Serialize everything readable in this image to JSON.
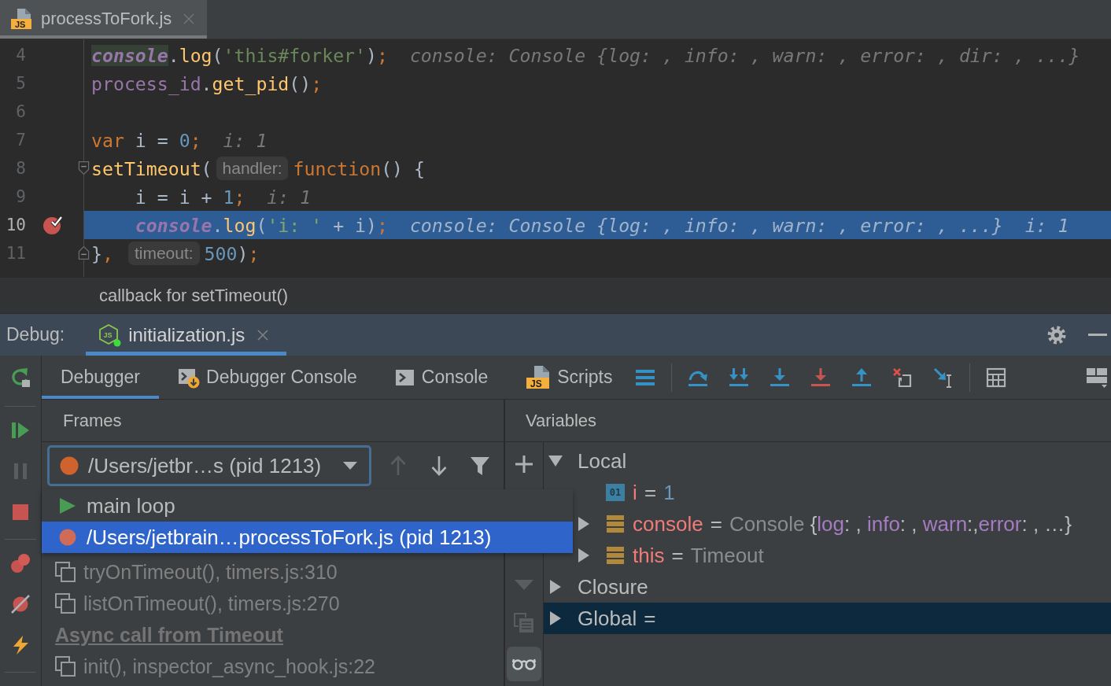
{
  "editor_tab": {
    "icon_text": "JS",
    "title": "processToFork.js",
    "selected": true
  },
  "editor": {
    "lines": [
      {
        "number": "4",
        "kind": "plain",
        "breakpoint": false,
        "current": false,
        "indented": false,
        "tokens": [
          {
            "kind": "usage",
            "text": "console"
          },
          {
            "kind": "plain",
            "text": "."
          },
          {
            "kind": "fn",
            "text": "log"
          },
          {
            "kind": "plain",
            "text": "("
          },
          {
            "kind": "str",
            "text": "'this#forker'"
          },
          {
            "kind": "plain",
            "text": ")"
          },
          {
            "kind": "kw",
            "text": ";"
          },
          {
            "kind": "value",
            "text": "console: Console {log: , info: , warn: , error: , dir: , ...}"
          }
        ]
      },
      {
        "number": "5",
        "kind": "plain",
        "breakpoint": false,
        "current": false,
        "indented": false,
        "tokens": [
          {
            "kind": "member",
            "text": "process_id"
          },
          {
            "kind": "plain",
            "text": "."
          },
          {
            "kind": "fn",
            "text": "get_pid"
          },
          {
            "kind": "plain",
            "text": "()"
          },
          {
            "kind": "kw",
            "text": ";"
          }
        ]
      },
      {
        "number": "6",
        "kind": "plain",
        "breakpoint": false,
        "current": false
      },
      {
        "number": "7",
        "kind": "plain",
        "breakpoint": false,
        "current": false,
        "indented": false,
        "tokens": [
          {
            "kind": "kw",
            "text": "var"
          },
          {
            "kind": "plain",
            "text": " i = "
          },
          {
            "kind": "num",
            "text": "0"
          },
          {
            "kind": "kw",
            "text": ";"
          },
          {
            "kind": "value",
            "text": "i: 1"
          }
        ]
      },
      {
        "number": "8",
        "kind": "foldstart",
        "breakpoint": false,
        "current": false,
        "indented": false,
        "tokens": [
          {
            "kind": "fn",
            "text": "setTimeout"
          },
          {
            "kind": "plain",
            "text": "("
          },
          {
            "kind": "hint",
            "text": "handler:"
          },
          {
            "kind": "kw",
            "text": "function"
          },
          {
            "kind": "plain",
            "text": "() {"
          }
        ]
      },
      {
        "number": "9",
        "kind": "plain",
        "breakpoint": false,
        "current": false,
        "indented": true,
        "tokens": [
          {
            "kind": "plain",
            "text": "i = i + "
          },
          {
            "kind": "num",
            "text": "1"
          },
          {
            "kind": "kw",
            "text": ";"
          },
          {
            "kind": "value",
            "text": "i: 1"
          }
        ]
      },
      {
        "number": "10",
        "kind": "plain",
        "breakpoint": true,
        "current": true,
        "indented": true,
        "tokens": [
          {
            "kind": "global",
            "text": "console"
          },
          {
            "kind": "plain",
            "text": "."
          },
          {
            "kind": "fn",
            "text": "log"
          },
          {
            "kind": "plain",
            "text": "("
          },
          {
            "kind": "str",
            "text": "'i: '"
          },
          {
            "kind": "plain",
            "text": " + i)"
          },
          {
            "kind": "kw",
            "text": ";"
          },
          {
            "kind": "value",
            "text": "console: Console {log: , info: , warn: , error: , ...}"
          },
          {
            "kind": "value",
            "text": "i: 1"
          }
        ]
      },
      {
        "number": "11",
        "kind": "foldend",
        "breakpoint": false,
        "current": false,
        "indented": false,
        "tokens": [
          {
            "kind": "plain",
            "text": "}"
          },
          {
            "kind": "kw",
            "text": ", "
          },
          {
            "kind": "hint",
            "text": "timeout:"
          },
          {
            "kind": "num",
            "text": "500"
          },
          {
            "kind": "plain",
            "text": ")"
          },
          {
            "kind": "kw",
            "text": ";"
          }
        ]
      }
    ]
  },
  "breadcrumb": "callback for setTimeout()",
  "debug": {
    "label": "Debug:",
    "sessions": [
      {
        "icon_text": "JS",
        "title": "initialization.js",
        "selected": true
      }
    ],
    "side_toolbar": [
      [
        {
          "kind": "rerun",
          "disabled": false
        }
      ],
      [
        {
          "kind": "resume",
          "disabled": false
        },
        {
          "kind": "pause",
          "disabled": true
        },
        {
          "kind": "stop",
          "disabled": false
        }
      ],
      [
        {
          "kind": "breakpoints",
          "disabled": false
        },
        {
          "kind": "mute",
          "disabled": false
        },
        {
          "kind": "lightning",
          "disabled": false
        }
      ]
    ],
    "view_tabs": [
      {
        "kind": "plain",
        "label": "Debugger",
        "selected": true
      },
      {
        "kind": "debugconsole",
        "label": "Debugger Console",
        "selected": false
      },
      {
        "kind": "console",
        "label": "Console",
        "selected": false
      },
      {
        "kind": "scripts",
        "icon_text": "JS",
        "label": "Scripts",
        "selected": false
      }
    ]
  },
  "frames": {
    "title": "Frames",
    "thread_dropdown": {
      "kind": "paused",
      "value": "/Users/jetbr…s (pid 1213)",
      "expanded": true,
      "options": [
        {
          "kind": "running",
          "label": "main loop",
          "selected": false
        },
        {
          "kind": "paused",
          "label": "/Users/jetbrain…processToFork.js (pid 1213)",
          "selected": true
        }
      ]
    },
    "nav": [
      {
        "kind": "up",
        "disabled": true
      },
      {
        "kind": "down",
        "disabled": false
      },
      {
        "kind": "filter",
        "disabled": false
      }
    ],
    "items": [
      {
        "kind": "frame",
        "label": "tryOnTimeout(), timers.js:310"
      },
      {
        "kind": "frame",
        "label": "listOnTimeout(), timers.js:270"
      },
      {
        "kind": "async",
        "label": "Async call from Timeout"
      },
      {
        "kind": "frame",
        "label": "init(), inspector_async_hook.js:22"
      }
    ]
  },
  "variables": {
    "title": "Variables",
    "tools": [
      {
        "kind": "add",
        "disabled": false,
        "on": false
      },
      {
        "kind": "down",
        "disabled": true,
        "on": false
      },
      {
        "kind": "copy",
        "disabled": true,
        "on": false
      },
      {
        "kind": "watches",
        "disabled": false,
        "on": true
      }
    ],
    "tree": [
      {
        "kind": "scope",
        "name": "Local",
        "expanded": true,
        "selected": false,
        "children": [
          {
            "kind": "number",
            "badge": "01",
            "name": "i",
            "eq": "=",
            "value_parts": [
              {
                "kind": "num",
                "text": "1"
              }
            ],
            "selected": false
          },
          {
            "kind": "object",
            "name": "console",
            "eq": "=",
            "value_parts": [
              {
                "kind": "type",
                "text": "Console "
              },
              {
                "kind": "punct",
                "text": "{"
              },
              {
                "kind": "key",
                "text": "log"
              },
              {
                "kind": "punct",
                "text": ": , "
              },
              {
                "kind": "key",
                "text": "info"
              },
              {
                "kind": "punct",
                "text": ": , "
              },
              {
                "kind": "key",
                "text": "warn"
              },
              {
                "kind": "punct",
                "text": ":,"
              },
              {
                "kind": "key",
                "text": "error"
              },
              {
                "kind": "punct",
                "text": ": , …}"
              }
            ],
            "expanded": false,
            "selected": false
          },
          {
            "kind": "object",
            "name": "this",
            "eq": "=",
            "value_parts": [
              {
                "kind": "type",
                "text": "Timeout"
              }
            ],
            "expanded": false,
            "selected": false
          }
        ]
      },
      {
        "kind": "scope",
        "name": "Closure",
        "expanded": false,
        "selected": false
      },
      {
        "kind": "scope",
        "name": "Global",
        "eq": "=",
        "expanded": false,
        "selected": true
      }
    ]
  }
}
